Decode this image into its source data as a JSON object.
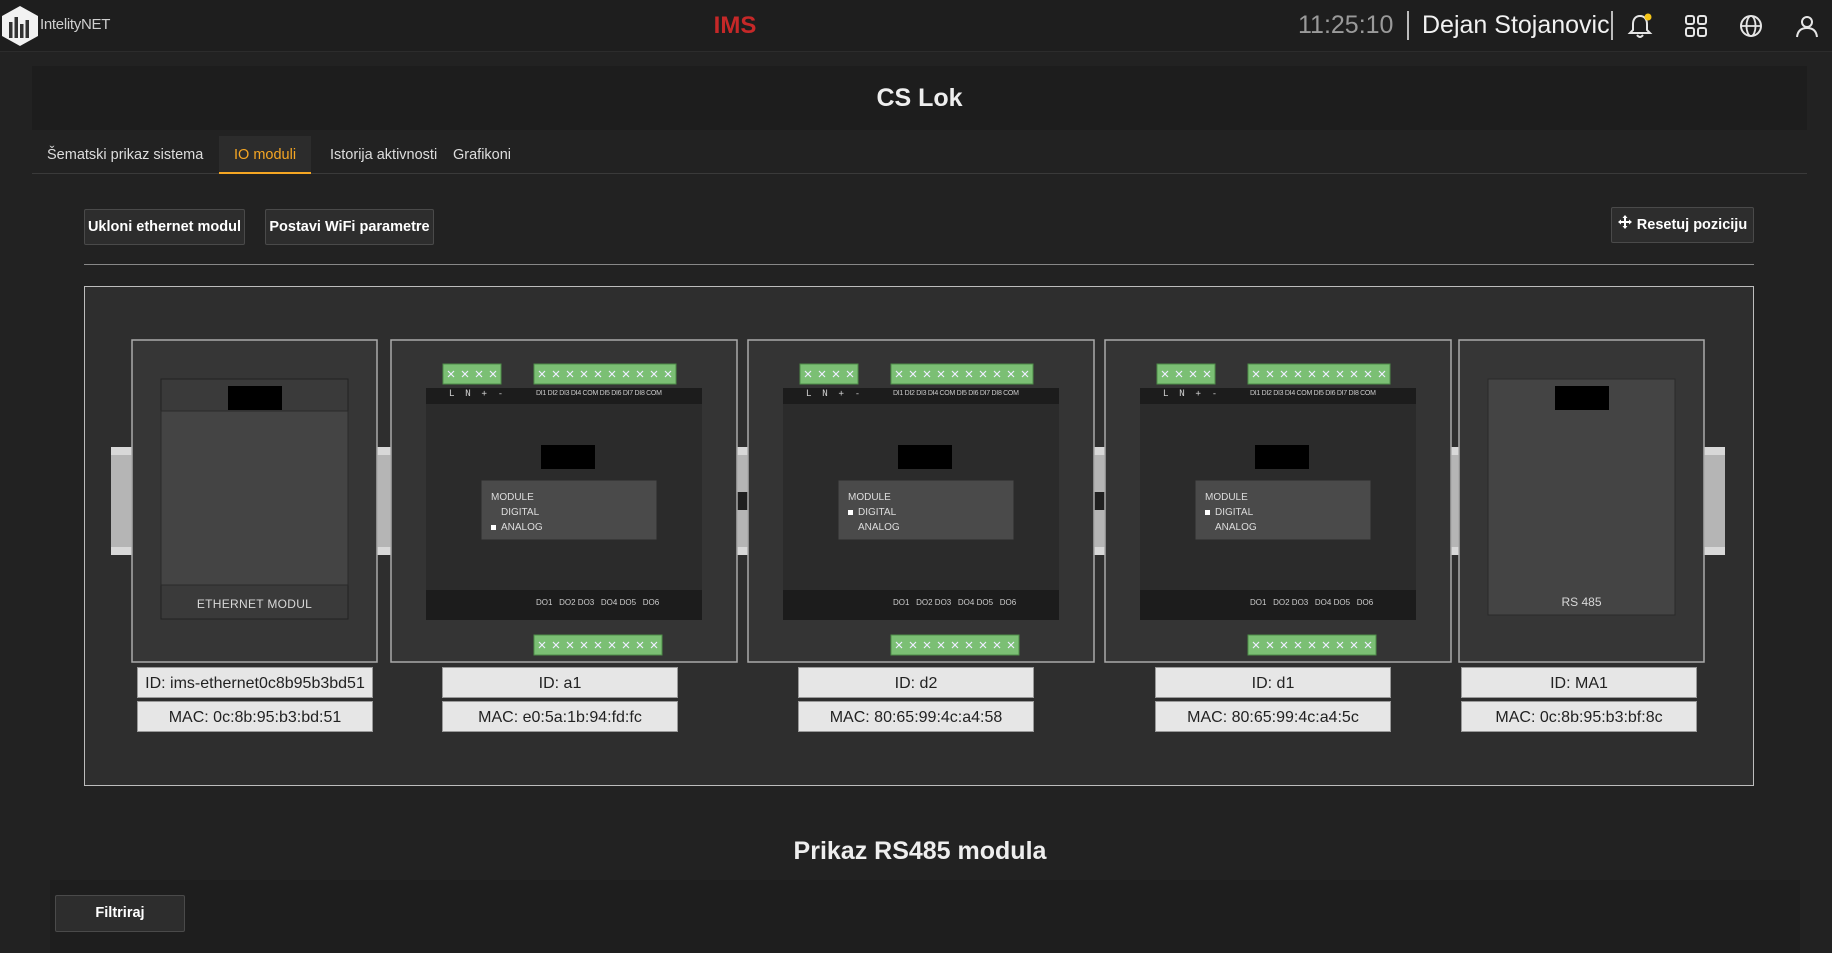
{
  "brand": "IntelityNET",
  "app_name": "IMS",
  "clock": "11:25:10",
  "user_name": "Dejan Stojanovic",
  "notification_dot_color": "#f5c518",
  "page_title": "CS Lok",
  "tabs": [
    {
      "label": "Šematski prikaz sistema",
      "active": false
    },
    {
      "label": "IO moduli",
      "active": true
    },
    {
      "label": "Istorija aktivnosti",
      "active": false
    },
    {
      "label": "Grafikoni",
      "active": false
    }
  ],
  "toolbar": {
    "remove_ethernet_label": "Ukloni ethernet modul",
    "wifi_params_label": "Postavi WiFi parametre",
    "reset_position_label": "Resetuj poziciju"
  },
  "modules": [
    {
      "kind": "ethernet",
      "panel_label": "ETHERNET MODUL",
      "id_text": "ID: ims-ethernet0c8b95b3bd51",
      "mac_text": "MAC: 0c:8b:95:b3:bd:51"
    },
    {
      "kind": "io",
      "selected_type": "ANALOG",
      "id_text": "ID: a1",
      "mac_text": "MAC: e0:5a:1b:94:fd:fc"
    },
    {
      "kind": "io",
      "selected_type": "DIGITAL",
      "id_text": "ID: d2",
      "mac_text": "MAC: 80:65:99:4c:a4:58"
    },
    {
      "kind": "io",
      "selected_type": "DIGITAL",
      "id_text": "ID: d1",
      "mac_text": "MAC: 80:65:99:4c:a4:5c"
    },
    {
      "kind": "rs485",
      "panel_label": "RS 485",
      "id_text": "ID: MA1",
      "mac_text": "MAC: 0c:8b:95:b3:bf:8c"
    }
  ],
  "io_module_labels": {
    "module": "MODULE",
    "digital": "DIGITAL",
    "analog": "ANALOG",
    "power_pins": "L  N  +  -",
    "input_pins": "DI1 DI2 DI3 DI4 COM DI5 DI6 DI7 DI8 COM",
    "output_pins": "DO1   DO2 DO3   DO4 DO5   DO6"
  },
  "rs485_section_title": "Prikaz RS485 modula",
  "filter_label": "Filtriraj"
}
